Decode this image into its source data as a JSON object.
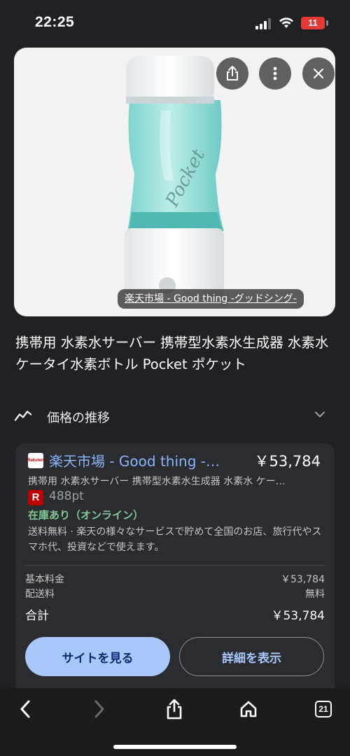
{
  "status_bar": {
    "time": "22:25",
    "battery": "11"
  },
  "hero": {
    "bottle_brand_text": "Pocket",
    "source_label": "楽天市場 - Good thing -グッドシング-",
    "icons": [
      "share-icon",
      "more-vert-icon",
      "close-icon"
    ]
  },
  "product": {
    "title": "携帯用 水素水サーバー 携帯型水素水生成器 水素水 ケータイ水素ボトル Pocket ポケット"
  },
  "price_history": {
    "label": "価格の推移"
  },
  "offer": {
    "store_name": "楽天市場 - Good thing -…",
    "store_icon_text": "Rakuten",
    "price": "￥53,784",
    "description": "携帯用 水素水サーバー 携帯型水素水生成器 水素水 ケー…",
    "points_icon": "R",
    "points": "488pt",
    "stock": "在庫あり（オンライン）",
    "shipping_note": "送料無料 · 楽天の様々なサービスで貯めて全国のお店、旅行代やスマホ代、投資などで使えます。",
    "base_price_label": "基本料金",
    "base_price_value": "￥53,784",
    "shipping_label": "配送料",
    "shipping_value": "無料",
    "total_label": "合計",
    "total_value": "￥53,784",
    "view_site_button": "サイトを見る",
    "details_button": "詳細を表示"
  },
  "toolbar": {
    "tabs_count": "21"
  },
  "colors": {
    "background": "#202124",
    "link": "#8ab4f8",
    "primary_button": "#a8c7fa",
    "stock_green": "#81c995",
    "rakuten_red": "#bf0000"
  }
}
